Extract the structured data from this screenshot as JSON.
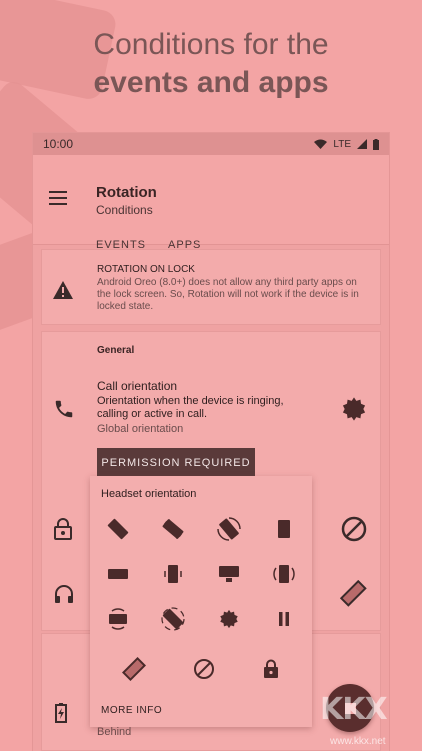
{
  "headline": {
    "line1": "Conditions for the",
    "line2": "events and apps"
  },
  "statusbar": {
    "time": "10:00",
    "network": "LTE"
  },
  "appbar": {
    "title": "Rotation",
    "subtitle": "Conditions",
    "tabs": [
      "EVENTS",
      "APPS"
    ],
    "active_tab": "EVENTS"
  },
  "lock_card": {
    "title": "ROTATION ON LOCK",
    "text": "Android Oreo (8.0+) does not allow any third party apps on the lock screen. So, Rotation will not work if the device is in locked state."
  },
  "general": {
    "title": "General",
    "call_title": "Call orientation",
    "call_desc": "Orientation when the device is ringing, calling or active in call.",
    "call_global": "Global orientation",
    "permission_button": "PERMISSION REQUIRED"
  },
  "second_card": {
    "behind_text": "Behind"
  },
  "popup": {
    "title": "Headset orientation",
    "options": [
      "auto-rotate-diagonal-icon",
      "rotate-icon",
      "rotate-arrows-icon",
      "portrait-icon",
      "landscape-icon",
      "portrait-rotate-icon",
      "landscape-lock-icon",
      "portrait-sensor-icon",
      "landscape-sensor-icon",
      "rotate-sensor-icon",
      "settings-icon",
      "pause-icon",
      "diagonal-icon",
      "block-icon",
      "lock-icon"
    ],
    "more_info": "MORE INFO"
  },
  "watermark": {
    "text": "KKX",
    "url": "www.kkx.net"
  },
  "colors": {
    "background": "#f3a4a4",
    "accent": "#5a3a3a",
    "fab": "#5a2e2e"
  }
}
